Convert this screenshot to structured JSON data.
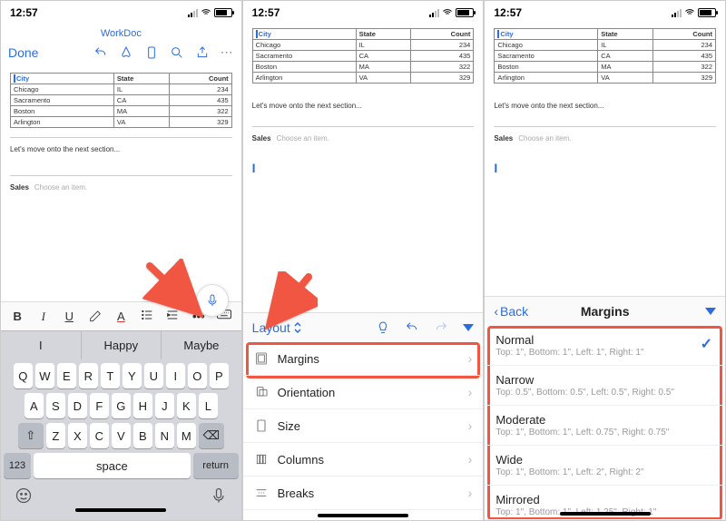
{
  "status": {
    "time": "12:57"
  },
  "doc": {
    "title": "WorkDoc",
    "done": "Done",
    "table": {
      "headers": [
        "City",
        "State",
        "Count"
      ],
      "rows": [
        [
          "Chicago",
          "IL",
          "234"
        ],
        [
          "Sacramento",
          "CA",
          "435"
        ],
        [
          "Boston",
          "MA",
          "322"
        ],
        [
          "Arlington",
          "VA",
          "329"
        ]
      ]
    },
    "next_line": "Let's move onto the next section...",
    "sales_label": "Sales",
    "sales_hint": "Choose an item."
  },
  "format_bar": {
    "bold": "B",
    "italic": "I",
    "under": "U",
    "more": "•••"
  },
  "kb": {
    "suggest": [
      "I",
      "Happy",
      "Maybe"
    ],
    "r1": [
      "Q",
      "W",
      "E",
      "R",
      "T",
      "Y",
      "U",
      "I",
      "O",
      "P"
    ],
    "r2": [
      "A",
      "S",
      "D",
      "F",
      "G",
      "H",
      "J",
      "K",
      "L"
    ],
    "r3": [
      "Z",
      "X",
      "C",
      "V",
      "B",
      "N",
      "M"
    ],
    "num": "123",
    "space": "space",
    "ret": "return"
  },
  "layout_menu": {
    "label": "Layout",
    "items": [
      {
        "label": "Margins"
      },
      {
        "label": "Orientation"
      },
      {
        "label": "Size"
      },
      {
        "label": "Columns"
      },
      {
        "label": "Breaks"
      }
    ]
  },
  "margins_panel": {
    "back": "Back",
    "title": "Margins",
    "options": [
      {
        "name": "Normal",
        "detail": "Top: 1\", Bottom: 1\", Left: 1\", Right: 1\"",
        "selected": true
      },
      {
        "name": "Narrow",
        "detail": "Top: 0.5\", Bottom: 0.5\", Left: 0.5\", Right: 0.5\""
      },
      {
        "name": "Moderate",
        "detail": "Top: 1\", Bottom: 1\", Left: 0.75\", Right: 0.75\""
      },
      {
        "name": "Wide",
        "detail": "Top: 1\", Bottom: 1\", Left: 2\", Right: 2\""
      },
      {
        "name": "Mirrored",
        "detail": "Top: 1\", Bottom: 1\", Left: 1.25\", Right: 1\""
      }
    ]
  }
}
